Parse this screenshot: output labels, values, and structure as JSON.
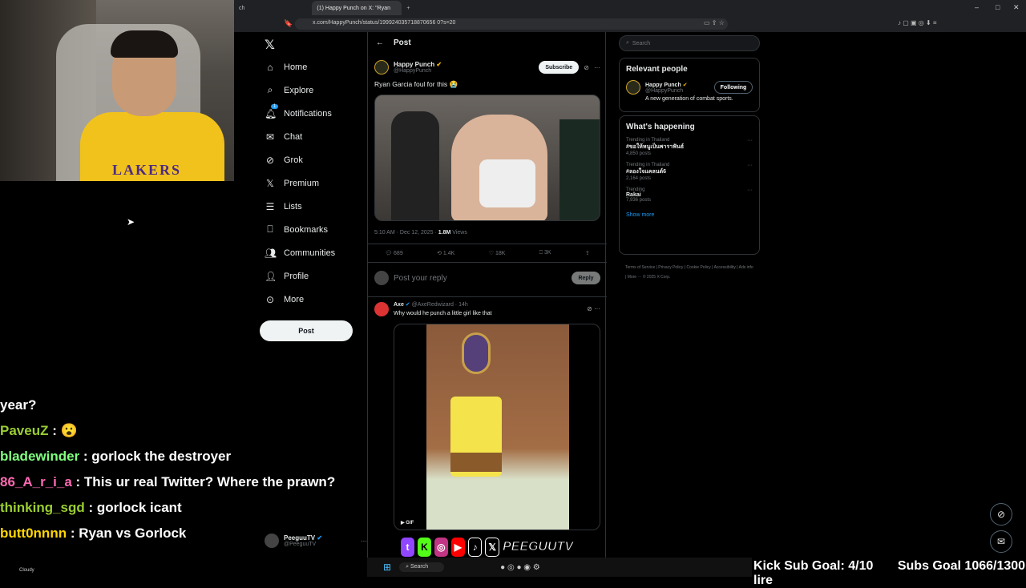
{
  "browser": {
    "tab_left": "ch",
    "tab_active": "(1) Happy Punch on X: \"Ryan",
    "url": "x.com/HappyPunch/status/199924035718870656 0?s=20"
  },
  "nav": {
    "home": "Home",
    "explore": "Explore",
    "notifications": "Notifications",
    "notif_badge": "1",
    "chat": "Chat",
    "grok": "Grok",
    "premium": "Premium",
    "lists": "Lists",
    "bookmarks": "Bookmarks",
    "communities": "Communities",
    "profile": "Profile",
    "more": "More",
    "post_button": "Post"
  },
  "account": {
    "name": "PeeguuTV",
    "handle": "@PeeguuTV"
  },
  "feed": {
    "title": "Post",
    "author_name": "Happy Punch",
    "author_handle": "@HappyPunch",
    "subscribe": "Subscribe",
    "text": "Ryan Garcia foul for this 😭",
    "timestamp": "5:10 AM · Dec 12, 2025 · ",
    "views_count": "1.8M",
    "views_label": " Views",
    "replies": "689",
    "reposts": "1.4K",
    "likes": "18K",
    "bookmarks": "3K",
    "reply_placeholder": "Post your reply",
    "reply_button": "Reply",
    "reply": {
      "name": "Axe",
      "handle": "@AxeRedwizard · 14h",
      "text": "Why would he punch a little girl like that",
      "gif_label": "GIF"
    }
  },
  "right": {
    "search_placeholder": "Search",
    "relevant_title": "Relevant people",
    "relevant_name": "Happy Punch",
    "relevant_handle": "@HappyPunch",
    "relevant_bio": "A new generation of combat sports.",
    "following": "Following",
    "happening_title": "What's happening",
    "trends": [
      {
        "context": "Trending in Thailand",
        "name": "#ขอให้หนูเป็นพาราฟันธ์",
        "posts": "4,850 posts"
      },
      {
        "context": "Trending in Thailand",
        "name": "#ลองใจแคลนด์6",
        "posts": "2,164 posts"
      },
      {
        "context": "Trending",
        "name": "Rakai",
        "posts": "7,936 posts"
      }
    ],
    "show_more": "Show more",
    "footer": "Terms of Service | Privacy Policy | Cookie Policy | Accessibility | Ads info | More ··· © 2025 X Corp."
  },
  "chat": [
    {
      "user": "",
      "msg": "year?",
      "color": "#ffffff"
    },
    {
      "user": "PaveuZ",
      "msg": " : 😮",
      "color": "#9acd32"
    },
    {
      "user": "bladewinder",
      "msg": " : gorlock the destroyer",
      "color": "#7fff7f"
    },
    {
      "user": "86_A_r_i_a",
      "msg": " : This ur real Twitter? Where the prawn?",
      "color": "#ff69b4"
    },
    {
      "user": "thinking_sgd",
      "msg": " : gorlock icant",
      "color": "#9acd32"
    },
    {
      "user": "butt0nnnn",
      "msg": " : Ryan vs Gorlock",
      "color": "#ffd700"
    }
  ],
  "overlay": {
    "brand": "PEEGUUTV",
    "kick_goal": "Kick Sub Goal: 4/10",
    "subs_goal": "Subs Goal 1066/1300 lire",
    "weather": "Cloudy",
    "taskbar_search": "Search"
  },
  "colors": {
    "verified": "#f4b400",
    "accent": "#1d9bf0",
    "bg": "#000000"
  }
}
